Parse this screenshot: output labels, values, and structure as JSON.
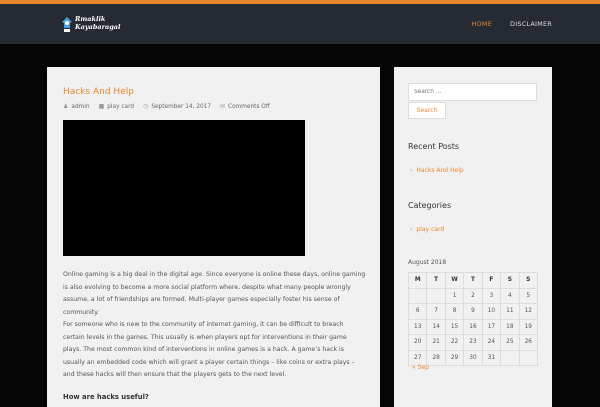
{
  "colors": {
    "accent": "#e8862e",
    "header_bg": "#262a33",
    "page_bg": "#050505",
    "panel_bg": "#f1f1f1"
  },
  "header": {
    "logo_text_line1": "Rmaklik",
    "logo_text_line2": "Kayabaragal",
    "nav": [
      "HOME",
      "DISCLAIMER"
    ]
  },
  "post": {
    "title": "Hacks And Help",
    "author": "admin",
    "category": "play card",
    "date": "September 14, 2017",
    "comments": "Comments Off",
    "paragraph1": "Online gaming is a big deal in the digital age. Since everyone is online these days, online gaming is also evolving to become a more social platform where, despite what many people wrongly assume, a lot of friendships are formed. Multi-player games especially foster his sense of community.",
    "paragraph2": "For someone who is new to the community of internet gaming, it can be difficult to breach certain levels in the games. This usually is when players opt for interventions in their game plays. The most common kind of interventions in online games is a hack. A game’s hack is usually an embedded code which will grant a player certain things – like coins or extra plays – and these hacks will then ensure that the players gets to the next level.",
    "subheading": "How are hacks useful?"
  },
  "sidebar": {
    "search_placeholder": "Search …",
    "search_button": "Search",
    "recent_posts_title": "Recent Posts",
    "recent_posts": [
      "Hacks And Help"
    ],
    "categories_title": "Categories",
    "categories": [
      "play card"
    ],
    "calendar": {
      "caption": "August 2018",
      "days": [
        "M",
        "T",
        "W",
        "T",
        "F",
        "S",
        "S"
      ],
      "weeks": [
        [
          "",
          "",
          "1",
          "2",
          "3",
          "4",
          "5"
        ],
        [
          "6",
          "7",
          "8",
          "9",
          "10",
          "11",
          "12"
        ],
        [
          "13",
          "14",
          "15",
          "16",
          "17",
          "18",
          "19"
        ],
        [
          "20",
          "21",
          "22",
          "23",
          "24",
          "25",
          "26"
        ],
        [
          "27",
          "28",
          "29",
          "30",
          "31",
          "",
          ""
        ]
      ],
      "prev_link": "« Sep"
    }
  }
}
